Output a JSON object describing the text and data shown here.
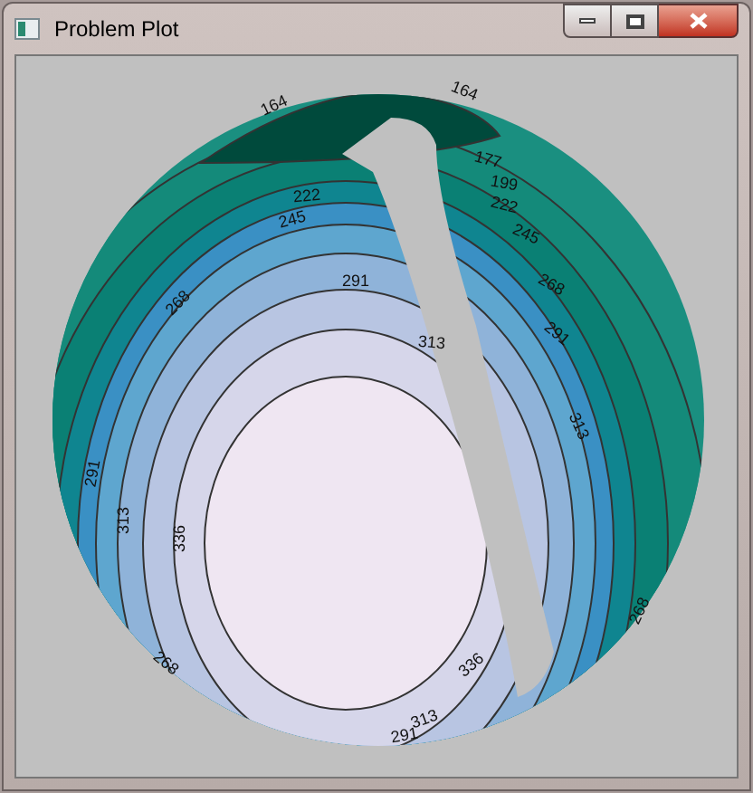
{
  "window": {
    "title": "Problem Plot"
  },
  "plot": {
    "contour_labels": [
      "164",
      "164",
      "177",
      "199",
      "222",
      "222",
      "245",
      "245",
      "268",
      "268",
      "291",
      "291",
      "313",
      "313",
      "291",
      "313",
      "336",
      "336",
      "313",
      "291",
      "268",
      "268"
    ]
  }
}
